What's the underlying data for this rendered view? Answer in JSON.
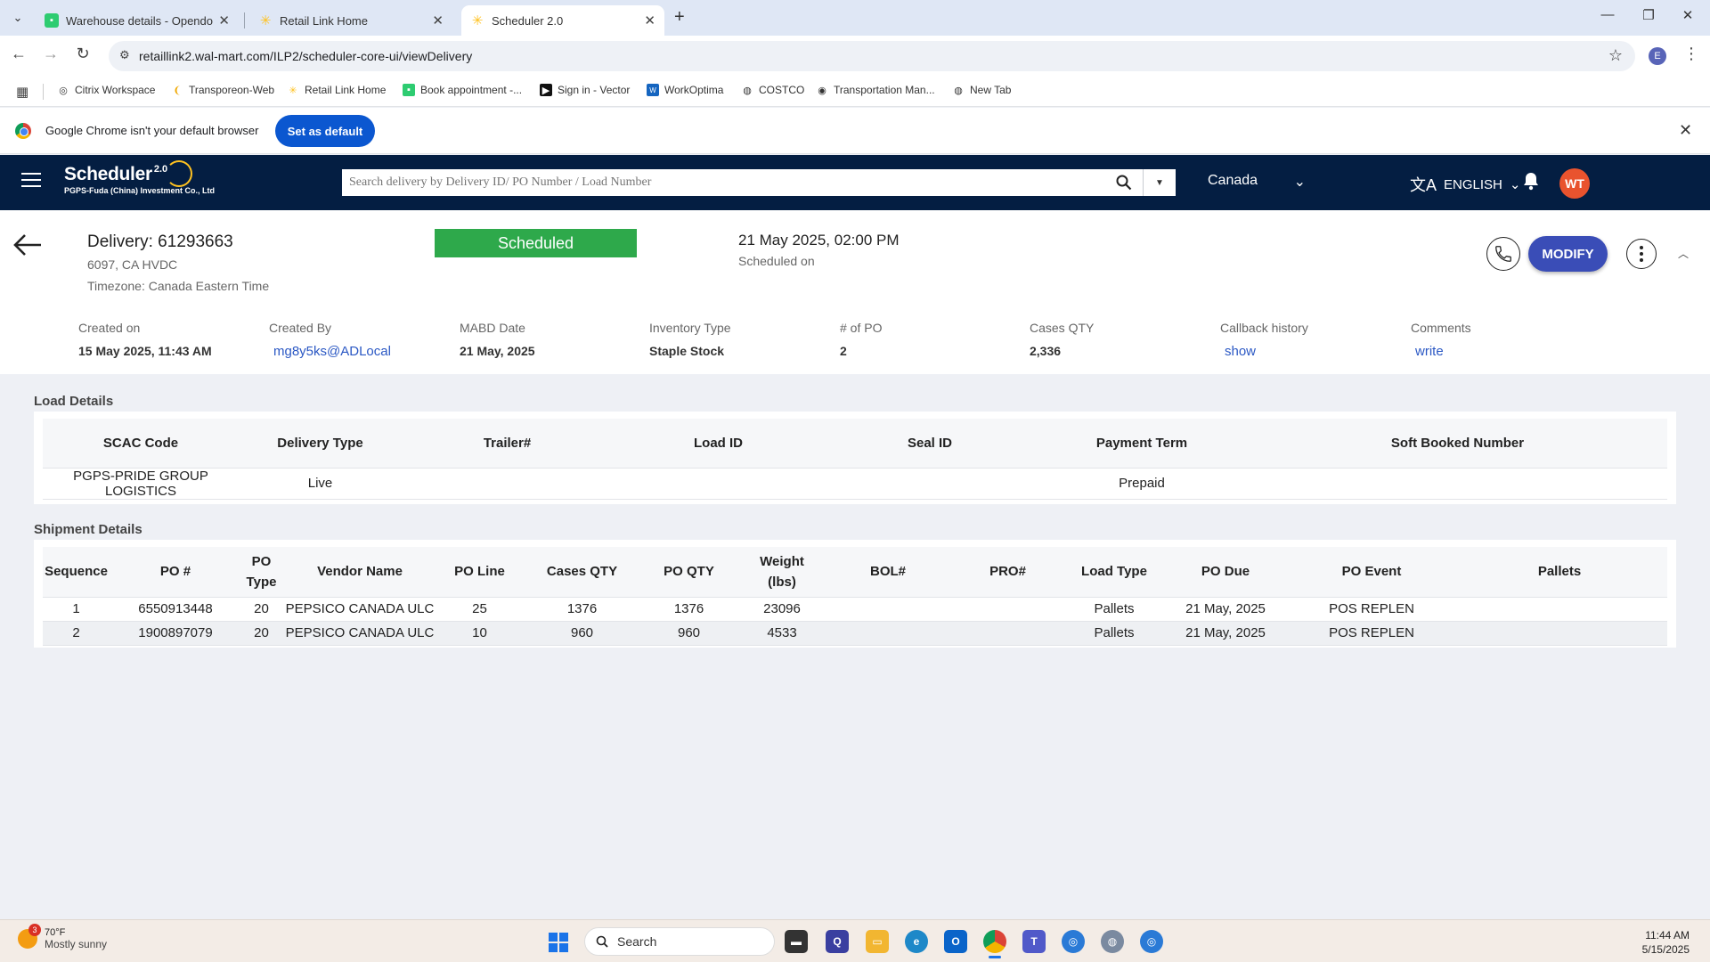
{
  "browser": {
    "tabs": [
      {
        "title": "Warehouse details - Opendock",
        "active": false
      },
      {
        "title": "Retail Link Home",
        "active": false
      },
      {
        "title": "Scheduler 2.0",
        "active": true
      }
    ],
    "url": "retaillink2.wal-mart.com/ILP2/scheduler-core-ui/viewDelivery",
    "profile_initial": "E",
    "bookmarks": [
      "Citrix Workspace",
      "Transporeon-Web",
      "Retail Link Home",
      "Book appointment -...",
      "Sign in - Vector",
      "WorkOptima",
      "COSTCO",
      "Transportation Man...",
      "New Tab"
    ],
    "infobar_message": "Google Chrome isn't your default browser",
    "infobar_button": "Set as default"
  },
  "app": {
    "name": "Scheduler",
    "version": "2.0",
    "org": "PGPS-Fuda (China) Investment Co., Ltd",
    "search_placeholder": "Search delivery by Delivery ID/ PO Number / Load Number",
    "country": "Canada",
    "language": "ENGLISH",
    "user_initials": "WT"
  },
  "delivery": {
    "title": "Delivery: 61293663",
    "location": "6097, CA HVDC",
    "timezone": "Timezone: Canada Eastern Time",
    "status": "Scheduled",
    "scheduled_datetime": "21 May 2025, 02:00 PM",
    "scheduled_label": "Scheduled on",
    "modify_label": "MODIFY",
    "meta": [
      {
        "label": "Created on",
        "value": "15 May 2025, 11:43 AM",
        "kind": "text"
      },
      {
        "label": "Created By",
        "value": "mg8y5ks@ADLocal",
        "kind": "link"
      },
      {
        "label": "MABD Date",
        "value": "21 May, 2025",
        "kind": "text"
      },
      {
        "label": "Inventory Type",
        "value": "Staple Stock",
        "kind": "text"
      },
      {
        "label": "# of PO",
        "value": "2",
        "kind": "text"
      },
      {
        "label": "Cases QTY",
        "value": "2,336",
        "kind": "text"
      },
      {
        "label": "Callback history",
        "value": "show",
        "kind": "link"
      },
      {
        "label": "Comments",
        "value": "write",
        "kind": "link"
      }
    ]
  },
  "load_details": {
    "title": "Load Details",
    "headers": [
      "SCAC Code",
      "Delivery Type",
      "Trailer#",
      "Load ID",
      "Seal ID",
      "Payment Term",
      "Soft Booked Number"
    ],
    "rows": [
      [
        "PGPS-PRIDE GROUP LOGISTICS",
        "Live",
        "",
        "",
        "",
        "Prepaid",
        ""
      ]
    ]
  },
  "shipment_details": {
    "title": "Shipment Details",
    "headers": [
      "Sequence",
      "PO #",
      "PO\nType",
      "Vendor Name",
      "PO Line",
      "Cases QTY",
      "PO QTY",
      "Weight\n(lbs)",
      "BOL#",
      "PRO#",
      "Load Type",
      "PO Due",
      "PO Event",
      "Pallets"
    ],
    "rows": [
      [
        "1",
        "6550913448",
        "20",
        "PEPSICO CANADA ULC",
        "25",
        "1376",
        "1376",
        "23096",
        "",
        "",
        "Pallets",
        "21 May, 2025",
        "POS REPLEN",
        ""
      ],
      [
        "2",
        "1900897079",
        "20",
        "PEPSICO CANADA ULC",
        "10",
        "960",
        "960",
        "4533",
        "",
        "",
        "Pallets",
        "21 May, 2025",
        "POS REPLEN",
        ""
      ]
    ]
  },
  "taskbar": {
    "weather_badge": "3",
    "weather_temp": "70°F",
    "weather_cond": "Mostly sunny",
    "search_label": "Search",
    "time": "11:44 AM",
    "date": "5/15/2025"
  }
}
